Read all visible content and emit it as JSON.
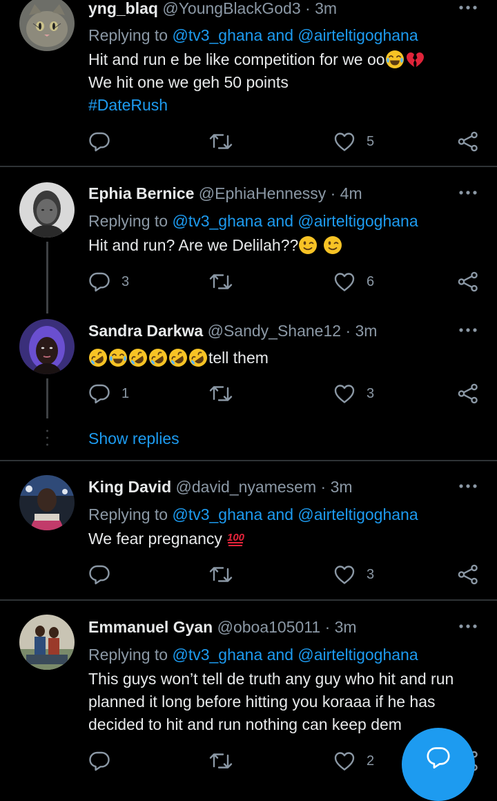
{
  "tweets": [
    {
      "name": "yng_blaq",
      "handle": "@YoungBlackGod3",
      "time": "· 3m",
      "replying_prefix": "Replying to",
      "replying_to": "@tv3_ghana and @airteltigoghana",
      "body_line1": "Hit and run e be like competition for we oo",
      "body_line2": "We hit one we geh 50 points",
      "hashtag": "#DateRush",
      "reply_count": "",
      "retweet_count": "",
      "like_count": "5",
      "emoji": [
        "face-with-tears-of-joy",
        "broken-heart"
      ]
    },
    {
      "name": "Ephia Bernice",
      "handle": "@EphiaHennessy",
      "time": "· 4m",
      "replying_prefix": "Replying to",
      "replying_to": "@tv3_ghana and @airteltigoghana",
      "body_line1": "Hit and run? Are we Delilah??",
      "reply_count": "3",
      "retweet_count": "",
      "like_count": "6",
      "emoji": [
        "winking-face",
        "winking-face"
      ]
    },
    {
      "name": "Sandra Darkwa",
      "handle": "@Sandy_Shane12",
      "time": "· 3m",
      "body_line1": "tell them",
      "reply_count": "1",
      "retweet_count": "",
      "like_count": "3",
      "emoji": [
        "rolling-on-floor-laughing",
        "face-with-tears-of-joy",
        "rolling-on-floor-laughing",
        "rolling-on-floor-laughing",
        "rolling-on-floor-laughing",
        "rolling-on-floor-laughing"
      ]
    },
    {
      "name": "King David",
      "handle": "@david_nyamesem",
      "time": "· 3m",
      "replying_prefix": "Replying to",
      "replying_to": "@tv3_ghana and @airteltigoghana",
      "body_line1": "We fear pregnancy",
      "reply_count": "",
      "retweet_count": "",
      "like_count": "3",
      "emoji": [
        "hundred-points"
      ]
    },
    {
      "name": "Emmanuel Gyan",
      "handle": "@oboa105011",
      "time": "· 3m",
      "replying_prefix": "Replying to",
      "replying_to": "@tv3_ghana and @airteltigoghana",
      "body_line1": "This guys won’t tell de truth any guy who hit and run",
      "body_line2": "planned it long before hitting you koraaa  if he has",
      "body_line3": "decided to hit and run nothing can keep dem",
      "reply_count": "",
      "retweet_count": "",
      "like_count": "2"
    }
  ],
  "show_replies": "Show replies",
  "colors": {
    "background": "#000000",
    "text": "#e7e9ea",
    "secondary": "#8b98a5",
    "accent": "#1d9bf0",
    "divider": "#2f3336"
  },
  "icons": [
    "reply-icon",
    "retweet-icon",
    "like-icon",
    "share-icon",
    "more-icon",
    "compose-reply-icon"
  ]
}
